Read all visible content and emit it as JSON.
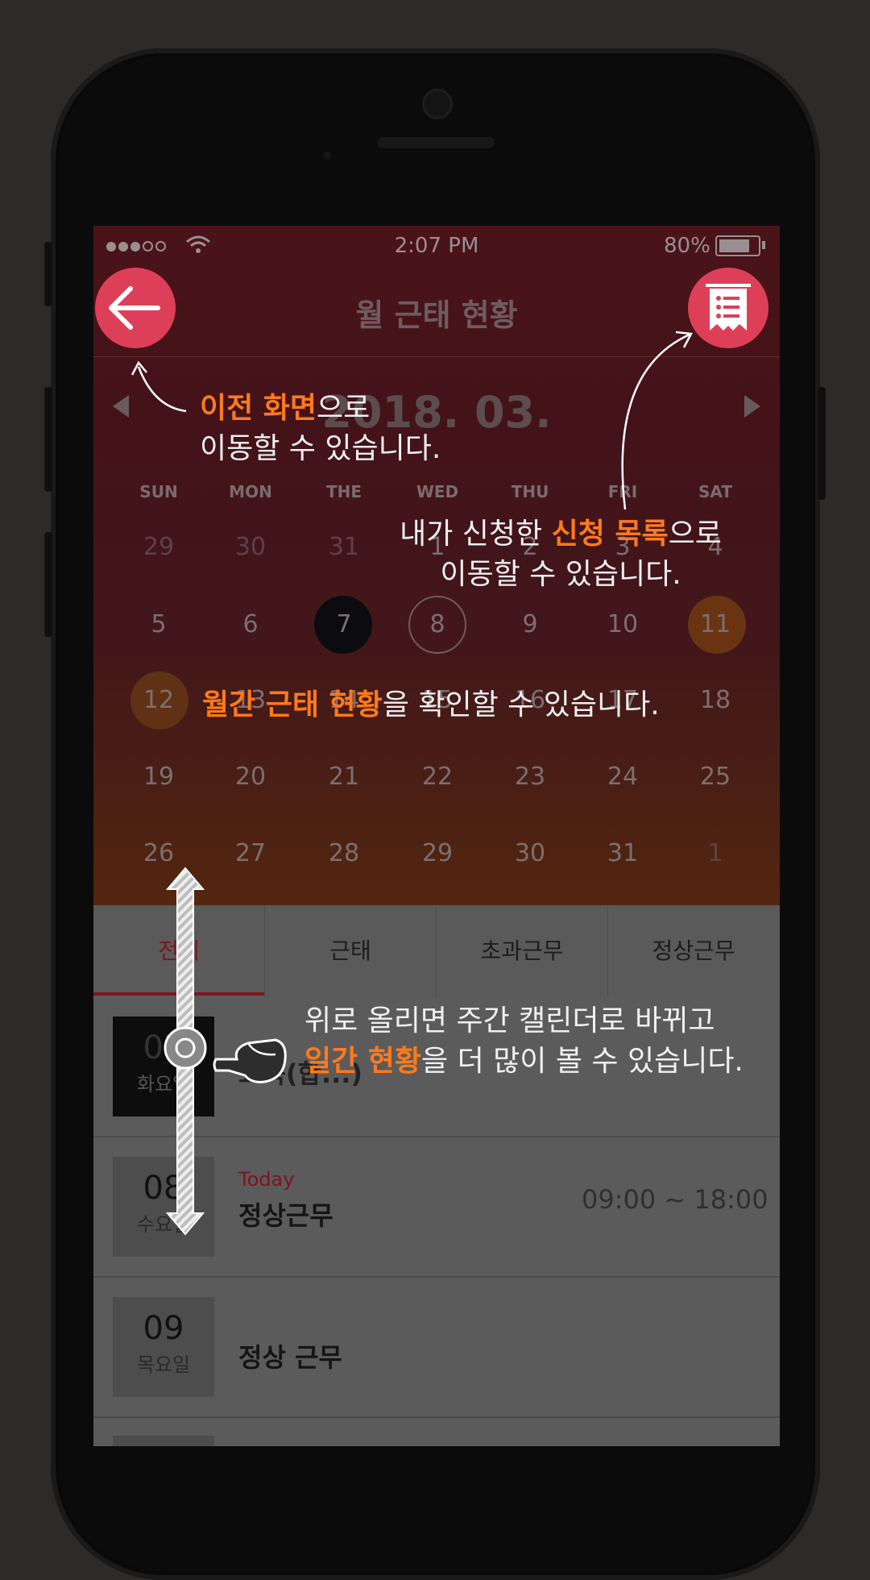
{
  "status_bar": {
    "time": "2:07 PM",
    "battery": "80%"
  },
  "header": {
    "title": "월 근태 현황",
    "back_icon": "arrow-left-icon",
    "list_icon": "request-list-icon"
  },
  "calendar": {
    "month_label": "2018. 03.",
    "weekdays": [
      "SUN",
      "MON",
      "THE",
      "WED",
      "THU",
      "FRI",
      "SAT"
    ],
    "weeks": [
      [
        "29",
        "30",
        "31",
        "1",
        "2",
        "3",
        "4"
      ],
      [
        "5",
        "6",
        "7",
        "8",
        "9",
        "10",
        "11"
      ],
      [
        "12",
        "13",
        "14",
        "15",
        "16",
        "17",
        "18"
      ],
      [
        "19",
        "20",
        "21",
        "22",
        "23",
        "24",
        "25"
      ],
      [
        "26",
        "27",
        "28",
        "29",
        "30",
        "31",
        "1"
      ]
    ]
  },
  "tabs": [
    "전체",
    "근태",
    "초과근무",
    "정상근무"
  ],
  "list": [
    {
      "date": "07",
      "weekday": "화요일",
      "title": "교육(합...)"
    },
    {
      "date": "08",
      "weekday": "수요일",
      "tag": "Today",
      "title": "정상근무",
      "time": "09:00 ~ 18:00"
    },
    {
      "date": "09",
      "weekday": "목요일",
      "title": "정상 근무"
    }
  ],
  "guide": {
    "back": {
      "hl": "이전 화면",
      "rest": "으로",
      "line2": "이동할 수 있습니다."
    },
    "request": {
      "pre": "내가 신청한 ",
      "hl": "신청 목록",
      "rest": "으로",
      "line2": "이동할 수 있습니다."
    },
    "monthly": {
      "hl": "월간 근태 현황",
      "rest": "을 확인할 수 있습니다."
    },
    "swipe": {
      "line1": "위로 올리면 주간 캘린더로 바뀌고",
      "hl": "일간 현황",
      "rest": "을 더 많이 볼 수 있습니다."
    }
  },
  "colors": {
    "accent": "#de3f58",
    "highlight": "#ff7a1c",
    "tab_active": "#7d1420"
  }
}
